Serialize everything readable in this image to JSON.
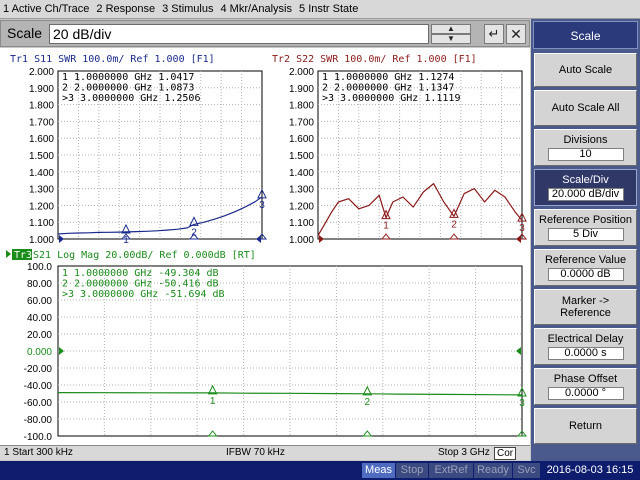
{
  "menu": [
    "1 Active Ch/Trace",
    "2 Response",
    "3 Stimulus",
    "4 Mkr/Analysis",
    "5 Instr State"
  ],
  "entry": {
    "label": "Scale",
    "value": "20 dB/div",
    "spin_up": "▲",
    "spin_down": "▼",
    "enter": "↵",
    "close": "✕"
  },
  "colors": {
    "tr1": "#1a2a8c",
    "tr2": "#8c1a1a",
    "tr3": "#1a8c1a"
  },
  "tr1": {
    "title": "Tr1 S11  SWR 100.0m/ Ref 1.000 [F1]",
    "markers": [
      {
        "id": "1",
        "prefix": " ",
        "freq": "1.0000000 GHz",
        "value": "1.0417"
      },
      {
        "id": "2",
        "prefix": " ",
        "freq": "2.0000000 GHz",
        "value": "1.0873"
      },
      {
        "id": "3",
        "prefix": ">",
        "freq": "3.0000000 GHz",
        "value": "1.2506"
      }
    ]
  },
  "tr2": {
    "title": "Tr2 S22  SWR 100.0m/ Ref 1.000 [F1]",
    "markers": [
      {
        "id": "1",
        "prefix": " ",
        "freq": "1.0000000 GHz",
        "value": "1.1274"
      },
      {
        "id": "2",
        "prefix": " ",
        "freq": "2.0000000 GHz",
        "value": "1.1347"
      },
      {
        "id": "3",
        "prefix": ">",
        "freq": "3.0000000 GHz",
        "value": "1.1119"
      }
    ]
  },
  "tr3": {
    "title_tag": "Tr3",
    "title": " S21  Log Mag 20.00dB/ Ref 0.000dB [RT]",
    "markers": [
      {
        "id": "1",
        "prefix": " ",
        "freq": "1.0000000 GHz",
        "value": "-49.304 dB"
      },
      {
        "id": "2",
        "prefix": " ",
        "freq": "2.0000000 GHz",
        "value": "-50.416 dB"
      },
      {
        "id": "3",
        "prefix": ">",
        "freq": "3.0000000 GHz",
        "value": "-51.694 dB"
      }
    ]
  },
  "chart_data": [
    {
      "type": "line",
      "name": "Tr1 S11 SWR",
      "y_ticks": [
        "2.000",
        "1.900",
        "1.800",
        "1.700",
        "1.600",
        "1.500",
        "1.400",
        "1.300",
        "1.200",
        "1.100",
        "1.000"
      ],
      "ylim": [
        1.0,
        2.0
      ],
      "xlim": [
        0.0003,
        3
      ],
      "x": [
        0.0003,
        0.15,
        0.3,
        0.45,
        0.6,
        0.75,
        0.9,
        1.0,
        1.15,
        1.3,
        1.45,
        1.6,
        1.75,
        1.9,
        2.0,
        2.15,
        2.3,
        2.45,
        2.6,
        2.75,
        2.9,
        3.0
      ],
      "y": [
        1.03,
        1.034,
        1.036,
        1.037,
        1.039,
        1.04,
        1.041,
        1.042,
        1.044,
        1.046,
        1.049,
        1.053,
        1.058,
        1.066,
        1.087,
        1.1,
        1.118,
        1.138,
        1.162,
        1.19,
        1.222,
        1.251
      ]
    },
    {
      "type": "line",
      "name": "Tr2 S22 SWR",
      "y_ticks": [
        "2.000",
        "1.900",
        "1.800",
        "1.700",
        "1.600",
        "1.500",
        "1.400",
        "1.300",
        "1.200",
        "1.100",
        "1.000"
      ],
      "ylim": [
        1.0,
        2.0
      ],
      "xlim": [
        0.0003,
        3
      ],
      "x": [
        0.0003,
        0.1,
        0.2,
        0.3,
        0.45,
        0.6,
        0.75,
        0.9,
        1.0,
        1.1,
        1.25,
        1.4,
        1.55,
        1.7,
        1.85,
        2.0,
        2.15,
        2.3,
        2.45,
        2.6,
        2.75,
        2.9,
        3.0
      ],
      "y": [
        1.02,
        1.09,
        1.16,
        1.22,
        1.24,
        1.18,
        1.2,
        1.26,
        1.127,
        1.22,
        1.25,
        1.19,
        1.28,
        1.33,
        1.22,
        1.135,
        1.27,
        1.3,
        1.22,
        1.29,
        1.25,
        1.16,
        1.112
      ]
    },
    {
      "type": "line",
      "name": "Tr3 S21 Log Mag",
      "y_ticks": [
        "100.0",
        "80.00",
        "60.00",
        "40.00",
        "20.00",
        "0.000",
        "-20.00",
        "-40.00",
        "-60.00",
        "-80.00",
        "-100.0"
      ],
      "ylim": [
        -100,
        100
      ],
      "xlim": [
        0.0003,
        3
      ],
      "x": [
        0.0003,
        0.3,
        0.6,
        0.9,
        1.0,
        1.2,
        1.5,
        1.8,
        2.0,
        2.2,
        2.5,
        2.8,
        3.0
      ],
      "y": [
        -49.0,
        -49.1,
        -49.2,
        -49.3,
        -49.3,
        -49.6,
        -49.8,
        -50.1,
        -50.4,
        -50.7,
        -51.0,
        -51.4,
        -51.7
      ]
    }
  ],
  "status": {
    "start": "1  Start 300 kHz",
    "ifbw": "IFBW 70 kHz",
    "stop": "Stop 3 GHz",
    "cor": "Cor"
  },
  "bottom": {
    "meas": "Meas",
    "stop": "Stop",
    "extref": "ExtRef",
    "ready": "Ready",
    "svc": "Svc",
    "time": "2016-08-03 16:15"
  },
  "softkeys": {
    "title": "Scale",
    "auto_scale": "Auto Scale",
    "auto_scale_all": "Auto Scale All",
    "divisions_label": "Divisions",
    "divisions_value": "10",
    "scale_div_label": "Scale/Div",
    "scale_div_value": "20.000 dB/div",
    "ref_pos_label": "Reference Position",
    "ref_pos_value": "5 Div",
    "ref_val_label": "Reference Value",
    "ref_val_value": "0.0000 dB",
    "marker_ref_line1": "Marker ->",
    "marker_ref_line2": "Reference",
    "edelay_label": "Electrical Delay",
    "edelay_value": "0.0000 s",
    "phase_label": "Phase Offset",
    "phase_value": "0.0000 °",
    "return": "Return"
  }
}
